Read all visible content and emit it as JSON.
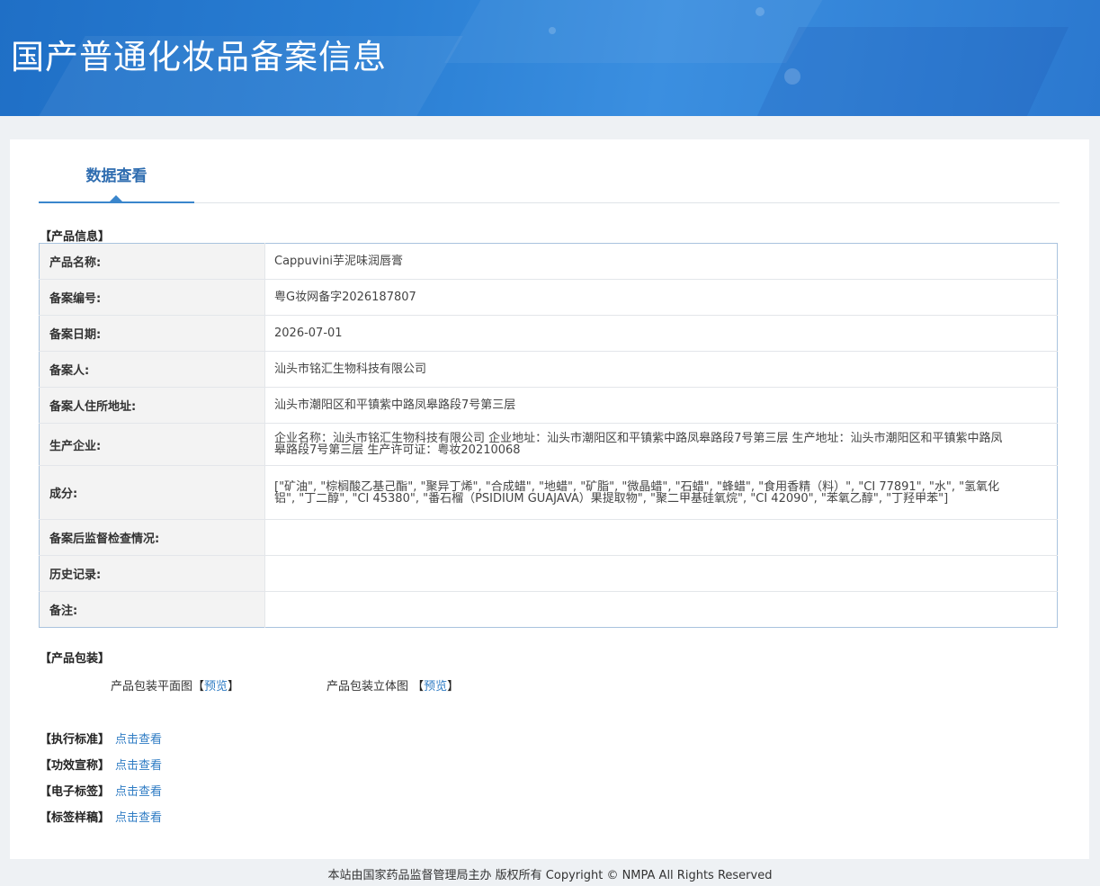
{
  "header": {
    "title": "国产普通化妆品备案信息"
  },
  "tabs": [
    {
      "label": "数据查看"
    }
  ],
  "sections": {
    "product_info": "【产品信息】",
    "packaging": "【产品包装】"
  },
  "product_info_rows": [
    {
      "key": "产品名称:",
      "value": "Cappuvini芋泥味润唇膏"
    },
    {
      "key": "备案编号:",
      "value": "粤G妆网备字2026187807"
    },
    {
      "key": "备案日期:",
      "value": "2026-07-01"
    },
    {
      "key": "备案人:",
      "value": "汕头市铭汇生物科技有限公司"
    },
    {
      "key": "备案人住所地址:",
      "value": "汕头市潮阳区和平镇紫中路凤皋路段7号第三层"
    },
    {
      "key": "生产企业:",
      "value": "企业名称：汕头市铭汇生物科技有限公司 企业地址：汕头市潮阳区和平镇紫中路凤皋路段7号第三层 生产地址：汕头市潮阳区和平镇紫中路凤皋路段7号第三层 生产许可证：粤妆20210068"
    },
    {
      "key": "成分:",
      "value": "[\"矿油\", \"棕榈酸乙基己酯\", \"聚异丁烯\", \"合成蜡\", \"地蜡\", \"矿脂\", \"微晶蜡\", \"石蜡\", \"蜂蜡\", \"食用香精（料）\", \"CI 77891\", \"水\", \"氢氧化铝\", \"丁二醇\", \"CI 45380\", \"番石榴（PSIDIUM GUAJAVA）果提取物\", \"聚二甲基硅氧烷\", \"CI 42090\", \"苯氧乙醇\", \"丁羟甲苯\"]"
    },
    {
      "key": "备案后监督检查情况:",
      "value": ""
    },
    {
      "key": "历史记录:",
      "value": ""
    },
    {
      "key": "备注:",
      "value": ""
    }
  ],
  "packaging": {
    "flat": {
      "label": "产品包装平面图",
      "open": "【",
      "link": "预览",
      "close": "】"
    },
    "stereo": {
      "label": "产品包装立体图 ",
      "open": "【",
      "link": "预览",
      "close": "】"
    }
  },
  "extras": [
    {
      "label": "【执行标准】",
      "link": "点击查看"
    },
    {
      "label": "【功效宣称】",
      "link": "点击查看"
    },
    {
      "label": "【电子标签】",
      "link": "点击查看"
    },
    {
      "label": "【标签样稿】",
      "link": "点击查看"
    }
  ],
  "footer": {
    "text": "本站由国家药品监督管理局主办 版权所有 Copyright © NMPA All Rights Reserved"
  }
}
